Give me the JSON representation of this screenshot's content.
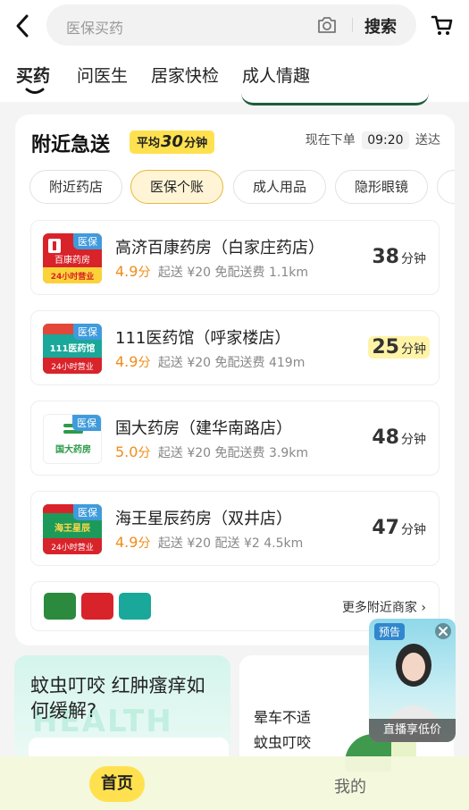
{
  "search": {
    "placeholder": "医保买药",
    "button": "搜索"
  },
  "tabs": [
    {
      "label": "买药",
      "active": true
    },
    {
      "label": "问医生"
    },
    {
      "label": "居家快检"
    },
    {
      "label": "成人情趣"
    }
  ],
  "nearby": {
    "title": "附近急送",
    "avg_prefix": "平均",
    "avg_num": "30",
    "avg_suffix": "分钟",
    "eta_prefix": "现在下单",
    "eta_time": "09:20",
    "eta_suffix": "送达",
    "chips": [
      "附近药店",
      "医保个账",
      "成人用品",
      "隐形眼镜"
    ],
    "active_chip": 1,
    "stores": [
      {
        "name": "高济百康药房（白家庄药店）",
        "badge": "医保",
        "logo_text": "百康药房",
        "logo_sub": "24小时营业",
        "rating": "4.9",
        "rating_unit": "分",
        "min_order": "起送 ¥20",
        "delivery": "免配送费",
        "distance": "1.1km",
        "time_num": "38",
        "time_unit": "分钟",
        "highlight": false
      },
      {
        "name": "111医药馆（呼家楼店）",
        "badge": "医保",
        "logo_text": "111医药馆",
        "logo_sub": "24小时营业",
        "rating": "4.9",
        "rating_unit": "分",
        "min_order": "起送 ¥20",
        "delivery": "免配送费",
        "distance": "419m",
        "time_num": "25",
        "time_unit": "分钟",
        "highlight": true
      },
      {
        "name": "国大药房（建华南路店）",
        "badge": "医保",
        "logo_text": "国大药房",
        "logo_sub": "",
        "rating": "5.0",
        "rating_unit": "分",
        "min_order": "起送 ¥20",
        "delivery": "免配送费",
        "distance": "3.9km",
        "time_num": "48",
        "time_unit": "分钟",
        "highlight": false
      },
      {
        "name": "海王星辰药房（双井店）",
        "badge": "医保",
        "logo_text": "海王星辰",
        "logo_sub": "24小时营业",
        "rating": "4.9",
        "rating_unit": "分",
        "min_order": "起送 ¥20",
        "delivery": "配送 ¥2",
        "distance": "4.5km",
        "time_num": "47",
        "time_unit": "分钟",
        "highlight": false
      }
    ],
    "more": "更多附近商家"
  },
  "banners": {
    "left_title": "蚊虫叮咬 红肿瘙痒如何缓解?",
    "left_watermark": "HEALTH",
    "right_line1": "晕车不适",
    "right_line2": "蚊虫叮咬"
  },
  "live": {
    "tag": "预告",
    "caption": "直播享低价"
  },
  "tabbar": {
    "home": "首页",
    "mine": "我的"
  },
  "colors": {
    "accent": "#ffe14f",
    "rating": "#f08c1a",
    "badge": "#3f9bdc"
  }
}
